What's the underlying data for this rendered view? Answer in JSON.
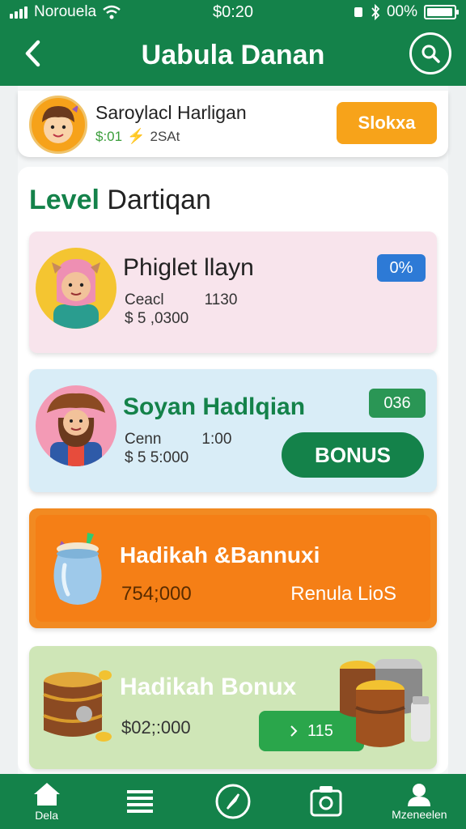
{
  "status_bar": {
    "carrier": "Norouela",
    "time": "$0:20",
    "battery": "00%"
  },
  "app_bar": {
    "title": "Uabula Danan"
  },
  "profile": {
    "name": "Saroylacl Harligan",
    "coins": "$:01",
    "level": "2SAt",
    "action_label": "Slokxa"
  },
  "section": {
    "title_accent": "Level",
    "title_rest": "Dartiqan"
  },
  "cards": [
    {
      "name": "Phiglet llayn",
      "badge": "0%",
      "meta_label": "Ceacl",
      "meta_value": "1130",
      "amount": "$ 5 ,0300"
    },
    {
      "name": "Soyan Hadlqian",
      "badge": "036",
      "meta_label": "Cenn",
      "meta_value": "1:00",
      "amount": "$ 5 5:000",
      "button_label": "BONUS"
    },
    {
      "title": "Hadikah &Bannuxi",
      "amount": "754;000",
      "subtitle": "Renula LioS"
    },
    {
      "title": "Hadikah Bonux",
      "amount": "$02;:000",
      "pill_value": "115"
    }
  ],
  "bottom_nav": [
    {
      "label": "Dela",
      "icon": "home-icon"
    },
    {
      "label": "",
      "icon": "menu-icon"
    },
    {
      "label": "",
      "icon": "compass-icon"
    },
    {
      "label": "",
      "icon": "wallet-icon"
    },
    {
      "label": "Mzeneelen",
      "icon": "profile-icon"
    }
  ],
  "colors": {
    "primary": "#14824a",
    "orange": "#f57f16",
    "accent_yellow": "#f7a31a",
    "blue_badge": "#2d7ad6"
  }
}
